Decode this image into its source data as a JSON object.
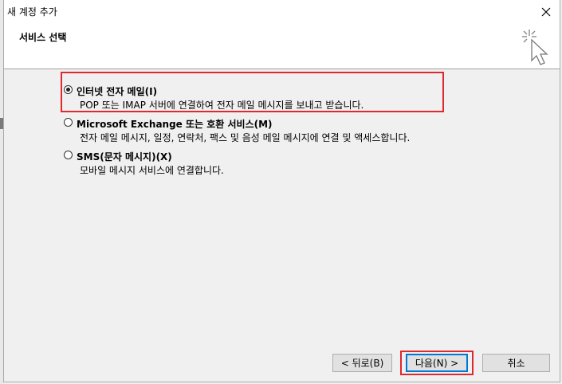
{
  "window": {
    "title": "새 계정 추가"
  },
  "header": {
    "title": "서비스 선택",
    "icon": "wizard-sparkle-cursor-icon"
  },
  "options": [
    {
      "label": "인터넷 전자 메일(I)",
      "description": "POP 또는 IMAP 서버에 연결하여 전자 메일 메시지를 보내고 받습니다.",
      "selected": true
    },
    {
      "label": "Microsoft Exchange 또는 호환 서비스(M)",
      "description": "전자 메일 메시지, 일정, 연락처, 팩스 및 음성 메일 메시지에 연결 및 액세스합니다.",
      "selected": false
    },
    {
      "label": "SMS(문자 메시지)(X)",
      "description": "모바일 메시지 서비스에 연결합니다.",
      "selected": false
    }
  ],
  "buttons": {
    "back": "< 뒤로(B)",
    "next": "다음(N) >",
    "cancel": "취소"
  },
  "colors": {
    "highlight": "#e0282f",
    "default_button_border": "#0078d7"
  }
}
